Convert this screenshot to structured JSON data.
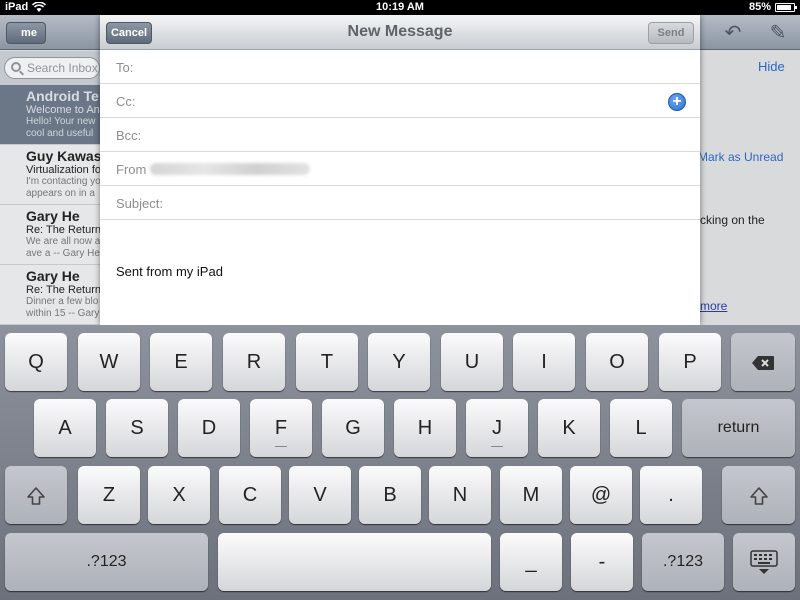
{
  "status_bar": {
    "device": "iPad",
    "time": "10:19 AM",
    "battery": "85%",
    "battery_level": 0.85
  },
  "background": {
    "back_label": "me",
    "search_placeholder": "Search Inbox",
    "hide_label": "Hide",
    "mark_unread_label": "Mark as Unread",
    "body_snippet": "cking on the",
    "more_label": "more",
    "messages": [
      {
        "from": "Android Te",
        "subject": "Welcome to An",
        "preview1": "Hello! Your new",
        "preview2": "cool and useful",
        "selected": true
      },
      {
        "from": "Guy Kawas",
        "subject": "Virtualization fo",
        "preview1": "I'm contacting yo",
        "preview2": "appears on in a"
      },
      {
        "from": "Gary He",
        "subject": "Re: The Return",
        "preview1": "We are all now a",
        "preview2": "ave a -- Gary He"
      },
      {
        "from": "Gary He",
        "subject": "Re: The Return",
        "preview1": "Dinner a few blo",
        "preview2": "within 15 -- Gary"
      }
    ]
  },
  "compose": {
    "title": "New Message",
    "cancel_label": "Cancel",
    "send_label": "Send",
    "to_label": "To:",
    "cc_label": "Cc:",
    "bcc_label": "Bcc:",
    "from_label": "From",
    "subject_label": "Subject:",
    "signature": "Sent from my iPad"
  },
  "keyboard": {
    "row1": [
      "Q",
      "W",
      "E",
      "R",
      "T",
      "Y",
      "U",
      "I",
      "O",
      "P"
    ],
    "row2": [
      "A",
      "S",
      "D",
      "F",
      "G",
      "H",
      "J",
      "K",
      "L"
    ],
    "row3": [
      "Z",
      "X",
      "C",
      "V",
      "B",
      "N",
      "M",
      "@",
      "."
    ],
    "return_label": "return",
    "numbers_label": ".?123",
    "underscore_label": "_",
    "dash_label": "-"
  }
}
